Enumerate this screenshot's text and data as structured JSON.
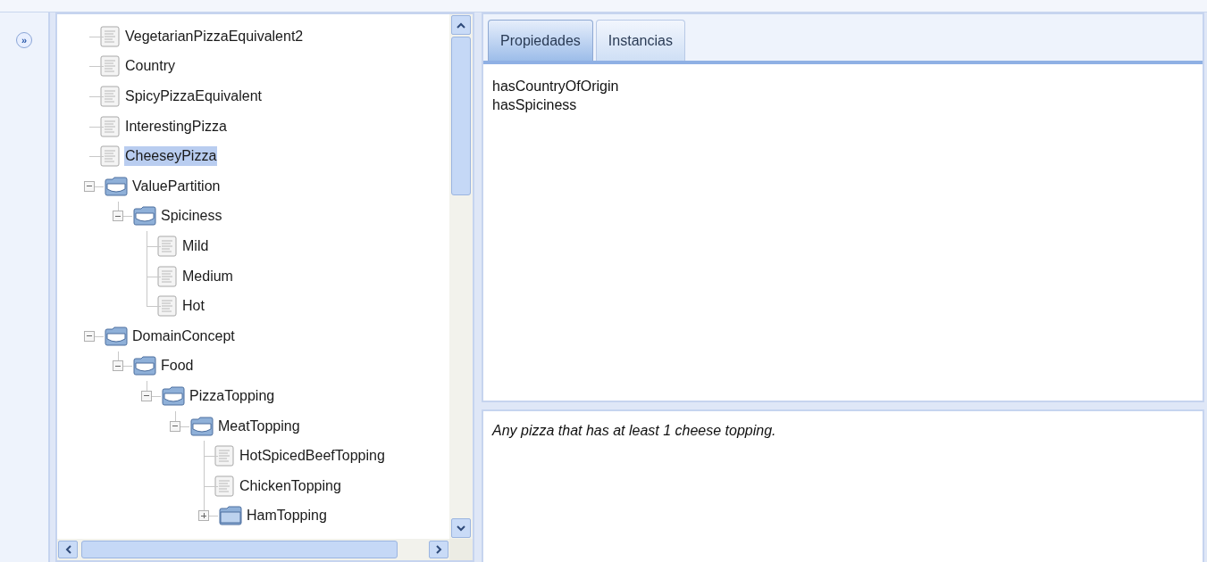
{
  "side_button": {
    "label": "»"
  },
  "tree": [
    {
      "label": "VegetarianPizzaEquivalent2",
      "kind": "item",
      "selected": false
    },
    {
      "label": "Country",
      "kind": "item",
      "selected": false
    },
    {
      "label": "SpicyPizzaEquivalent",
      "kind": "item",
      "selected": false
    },
    {
      "label": "InterestingPizza",
      "kind": "item",
      "selected": false
    },
    {
      "label": "CheeseyPizza",
      "kind": "item",
      "selected": true
    },
    {
      "label": "ValuePartition",
      "kind": "folder",
      "selected": false,
      "expanded": true,
      "children": [
        {
          "label": "Spiciness",
          "kind": "folder",
          "selected": false,
          "expanded": true,
          "children": [
            {
              "label": "Mild",
              "kind": "item",
              "selected": false
            },
            {
              "label": "Medium",
              "kind": "item",
              "selected": false
            },
            {
              "label": "Hot",
              "kind": "item",
              "selected": false
            }
          ]
        }
      ]
    },
    {
      "label": "DomainConcept",
      "kind": "folder",
      "selected": false,
      "expanded": true,
      "children": [
        {
          "label": "Food",
          "kind": "folder",
          "selected": false,
          "expanded": true,
          "children": [
            {
              "label": "PizzaTopping",
              "kind": "folder",
              "selected": false,
              "expanded": true,
              "children": [
                {
                  "label": "MeatTopping",
                  "kind": "folder",
                  "selected": false,
                  "expanded": true,
                  "children": [
                    {
                      "label": "HotSpicedBeefTopping",
                      "kind": "item",
                      "selected": false
                    },
                    {
                      "label": "ChickenTopping",
                      "kind": "item",
                      "selected": false
                    },
                    {
                      "label": "HamTopping",
                      "kind": "folder",
                      "selected": false,
                      "expanded": false
                    }
                  ]
                }
              ]
            }
          ]
        }
      ]
    }
  ],
  "tabs": [
    {
      "label": "Propiedades",
      "selected": true
    },
    {
      "label": "Instancias",
      "selected": false
    }
  ],
  "properties": [
    "hasCountryOfOrigin",
    "hasSpiciness"
  ],
  "description": "Any pizza that has at least 1 cheese topping."
}
